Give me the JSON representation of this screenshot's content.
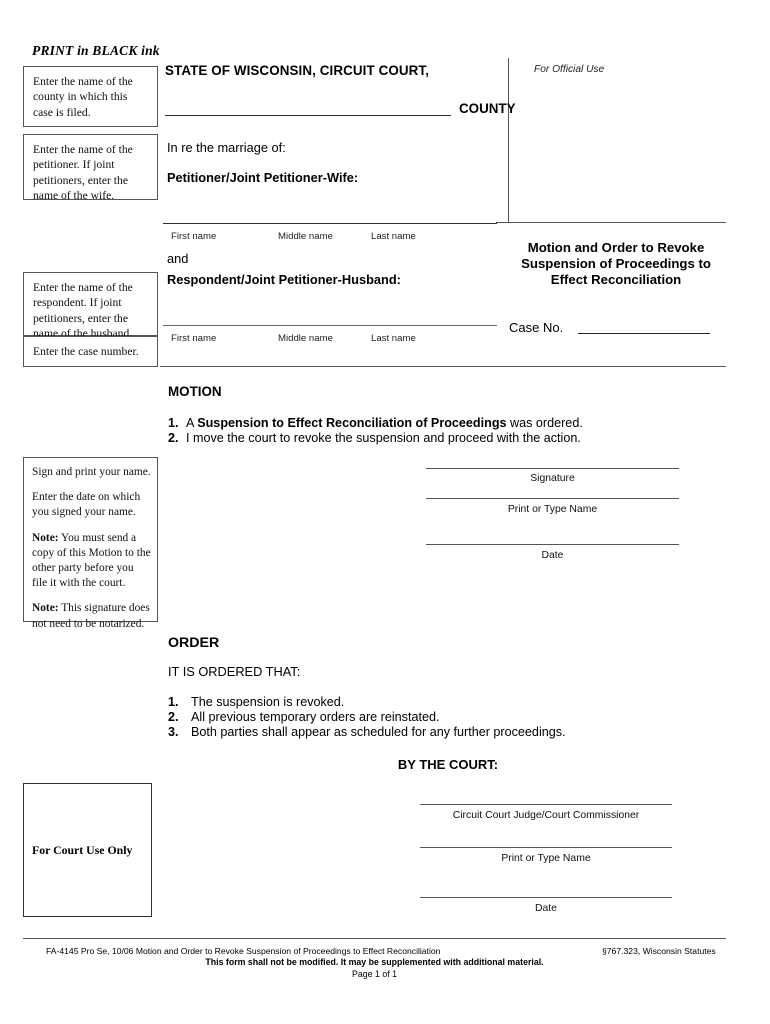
{
  "header": {
    "print_notice": "PRINT in BLACK ink"
  },
  "sidebar": {
    "county_instruction": "Enter the name of the county in which this case is filed.",
    "petitioner_instruction": "Enter the name of the petitioner.  If joint petitioners, enter the name of the wife.",
    "respondent_instruction": "Enter the name of the respondent.  If joint petitioners, enter the name of the husband.",
    "case_number_instruction": "Enter the case number.",
    "signature_instruction": {
      "line1": "Sign and print your name.",
      "line2": "Enter the date on which you signed your name.",
      "note1_label": "Note:",
      "note1_text": " You must send a copy of this Motion to the other party before you file it with the court.",
      "note2_label": "Note:",
      "note2_text": " This signature does not need to be notarized."
    },
    "court_use_label": "For Court Use Only"
  },
  "caption": {
    "state_line": "STATE OF WISCONSIN, CIRCUIT COURT,",
    "county_word": "COUNTY",
    "in_re": "In re the marriage of:",
    "petitioner_label": "Petitioner/Joint Petitioner-Wife:",
    "and": "and",
    "respondent_label": "Respondent/Joint Petitioner-Husband:",
    "name_labels": {
      "first": "First name",
      "middle": "Middle name",
      "last": "Last name"
    },
    "official_use": "For Official Use",
    "document_title": "Motion and Order to Revoke Suspension of Proceedings to Effect Reconciliation",
    "case_no_label": "Case No."
  },
  "motion": {
    "heading": "MOTION",
    "items": [
      {
        "number": "1.",
        "prefix": "A ",
        "bold": "Suspension to Effect Reconciliation of Proceedings",
        "suffix": " was ordered."
      },
      {
        "number": "2.",
        "prefix": "I move the court to revoke the suspension and proceed with the action.",
        "bold": "",
        "suffix": ""
      }
    ],
    "signature_blocks": [
      {
        "caption": "Signature"
      },
      {
        "caption": "Print or Type Name"
      },
      {
        "caption": "Date"
      }
    ]
  },
  "order": {
    "heading": "ORDER",
    "intro": "IT IS ORDERED THAT:",
    "items": [
      {
        "number": "1.",
        "text": "The suspension is revoked."
      },
      {
        "number": "2.",
        "text": "All previous temporary orders are reinstated."
      },
      {
        "number": "3.",
        "text": "Both parties shall appear as scheduled for any further proceedings."
      }
    ],
    "by_the_court": "BY THE COURT:",
    "signature_blocks": [
      {
        "caption": "Circuit Court Judge/Court Commissioner"
      },
      {
        "caption": "Print or Type Name"
      },
      {
        "caption": "Date"
      }
    ]
  },
  "footer": {
    "left": "FA-4145 Pro Se, 10/06 Motion and Order to Revoke Suspension of Proceedings to Effect Reconciliation",
    "right": "§767.323, Wisconsin Statutes",
    "middle": "This form shall not be modified.  It may be supplemented with additional material.",
    "page": "Page 1 of 1"
  }
}
